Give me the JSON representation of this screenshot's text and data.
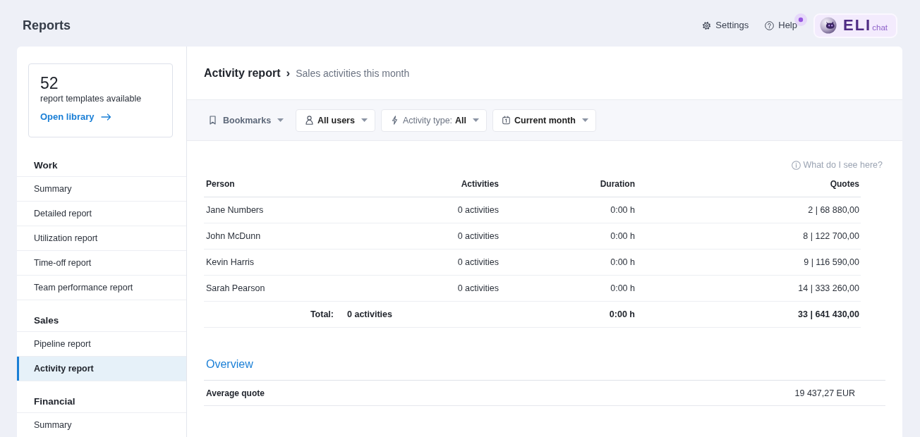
{
  "header": {
    "title": "Reports",
    "links": [
      {
        "kind": "settings",
        "label": "Settings",
        "notification": false
      },
      {
        "kind": "help",
        "label": "Help",
        "notification": true
      }
    ],
    "chat_button": {
      "logo": "ELI",
      "label": "chat"
    }
  },
  "sidebar": {
    "library_card": {
      "count": "52",
      "caption": "report templates available",
      "link": "Open library"
    },
    "sections": [
      {
        "title": "Work",
        "items": [
          {
            "label": "Summary",
            "selected": false
          },
          {
            "label": "Detailed report",
            "selected": false
          },
          {
            "label": "Utilization report",
            "selected": false
          },
          {
            "label": "Time-off report",
            "selected": false
          },
          {
            "label": "Team performance report",
            "selected": false
          }
        ]
      },
      {
        "title": "Sales",
        "items": [
          {
            "label": "Pipeline report",
            "selected": false
          },
          {
            "label": "Activity report",
            "selected": true
          }
        ]
      },
      {
        "title": "Financial",
        "items": [
          {
            "label": "Summary",
            "selected": false
          }
        ]
      }
    ]
  },
  "report_header": {
    "title": "Activity report",
    "separator": "›",
    "subtitle": "Sales activities this month"
  },
  "filters": [
    {
      "kind": "bookmarks",
      "label": "Bookmarks"
    },
    {
      "kind": "users",
      "label": "All users"
    },
    {
      "kind": "activity_type",
      "label": "Activity type:",
      "value": "All"
    },
    {
      "kind": "period",
      "label": "Current month"
    }
  ],
  "help_link": "What do I see here?",
  "table": {
    "columns": [
      "Person",
      "Activities",
      "Duration",
      "Quotes"
    ],
    "rows": [
      {
        "person": "Jane Numbers",
        "activities": "0 activities",
        "duration": "0:00 h",
        "quotes": "2 | 68 880,00"
      },
      {
        "person": "John McDunn",
        "activities": "0 activities",
        "duration": "0:00 h",
        "quotes": "8 | 122 700,00"
      },
      {
        "person": "Kevin Harris",
        "activities": "0 activities",
        "duration": "0:00 h",
        "quotes": "9 | 116 590,00"
      },
      {
        "person": "Sarah Pearson",
        "activities": "0 activities",
        "duration": "0:00 h",
        "quotes": "14 | 333 260,00"
      }
    ],
    "total": {
      "label": "Total:",
      "activities": "0 activities",
      "duration": "0:00 h",
      "quotes": "33 | 641 430,00"
    }
  },
  "overview": {
    "title": "Overview",
    "rows": [
      {
        "label": "Average quote",
        "value": "19 437,27 EUR"
      }
    ]
  }
}
